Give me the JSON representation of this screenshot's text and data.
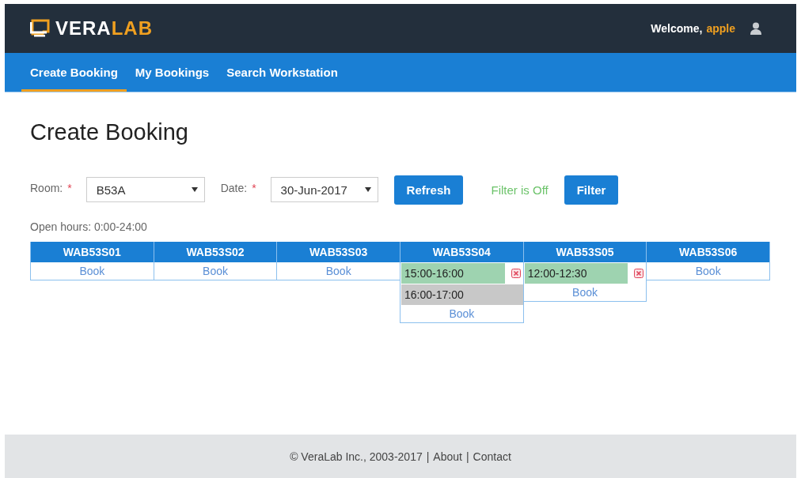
{
  "header": {
    "logo": {
      "primary": "VERA",
      "accent": "LAB"
    },
    "welcome": "Welcome,",
    "user": "apple"
  },
  "nav": [
    {
      "label": "Create Booking",
      "selected": true
    },
    {
      "label": "My Bookings",
      "selected": false
    },
    {
      "label": "Search Workstation",
      "selected": false
    }
  ],
  "title": "Create Booking",
  "form": {
    "room_label": "Room:",
    "room_required": "*",
    "room": "B53A",
    "date_label": "Date:",
    "date_required": "*",
    "date": "30-Jun-2017",
    "refresh_button": "Refresh",
    "filter_status": "Filter is Off",
    "filter_button": "Filter"
  },
  "open_hours": "Open hours: 0:00-24:00",
  "workstations": [
    {
      "name": "WAB53S01",
      "book": "Book"
    },
    {
      "name": "WAB53S02",
      "book": "Book"
    },
    {
      "name": "WAB53S03",
      "book": "Book"
    },
    {
      "name": "WAB53S04",
      "slots": [
        {
          "time": "15:00-16:00",
          "kind": "mine"
        },
        {
          "time": "16:00-17:00",
          "kind": "taken"
        }
      ],
      "book": "Book"
    },
    {
      "name": "WAB53S05",
      "slots": [
        {
          "time": "12:00-12:30",
          "kind": "mine"
        }
      ],
      "book": "Book"
    },
    {
      "name": "WAB53S06",
      "book": "Book"
    }
  ],
  "footer": {
    "copyright": "© VeraLab Inc., 2003-2017",
    "links": [
      {
        "separator": "|",
        "label": "About"
      },
      {
        "separator": "|",
        "label": "Contact"
      }
    ]
  }
}
